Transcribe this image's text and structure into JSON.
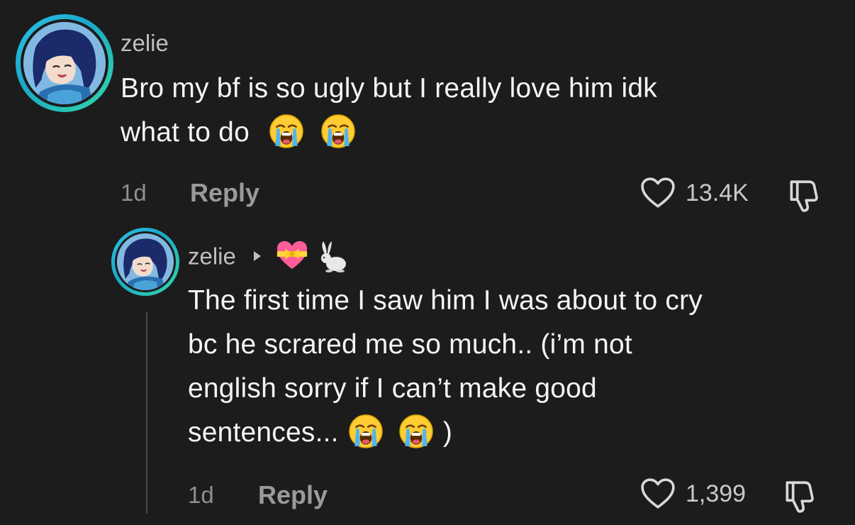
{
  "comments": [
    {
      "username": "zelie",
      "text_line1": "Bro my bf is so ugly but I really love him idk",
      "text_line2": "what to do",
      "emojis": [
        "loudly-crying-face",
        "loudly-crying-face"
      ],
      "time": "1d",
      "reply_label": "Reply",
      "like_count": "13.4K"
    }
  ],
  "reply": {
    "username": "zelie",
    "flair_emojis": [
      "heart-with-ribbon",
      "rabbit"
    ],
    "text_line1": "The first time I saw him I was about to cry",
    "text_line2": "bc he scrared me so much.. (i’m not",
    "text_line3": "english sorry if I can’t make good",
    "text_line4_start": "sentences...",
    "text_line4_end": ")",
    "time": "1d",
    "reply_label": "Reply",
    "like_count": "1,399"
  },
  "colors": {
    "background": "#1c1c1c",
    "avatar_ring_start": "#2ec5e8",
    "avatar_ring_end": "#33d6a6"
  }
}
